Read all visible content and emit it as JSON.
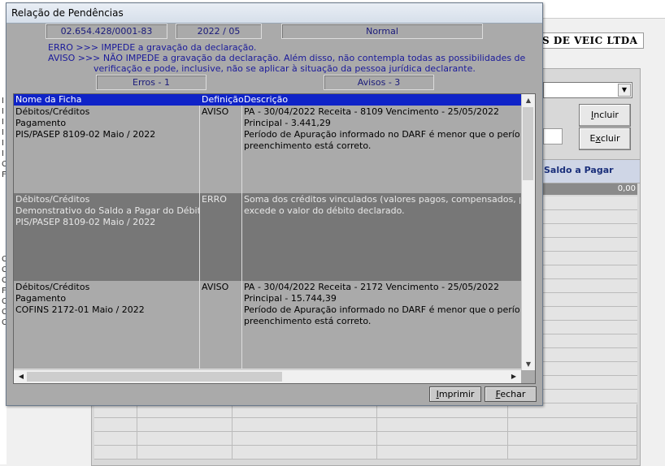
{
  "background": {
    "company_name": "S DE VEIC LTDA",
    "left_letters": [
      "I",
      "I",
      "I",
      "I",
      "I",
      "I",
      "C",
      "F",
      "",
      "",
      "",
      "",
      "",
      "",
      "",
      "C",
      "C",
      "C",
      "F",
      "C",
      "C",
      "C"
    ],
    "buttons": {
      "incluir": "Incluir",
      "excluir": "Excluir"
    },
    "saldo_header": "Saldo a Pagar",
    "saldo_value": "0,00"
  },
  "dialog": {
    "title": "Relação de Pendências",
    "cnpj": "02.654.428/0001-83",
    "periodo": "2022 / 05",
    "tipo": "Normal",
    "legend_erro": "ERRO >>>  IMPEDE a gravação da declaração.",
    "legend_aviso_1": "AVISO >>>  NÃO IMPEDE a gravação da declaração. Além disso, não contempla todas as possibilidades de",
    "legend_aviso_2": "verificação e pode, inclusive, não se aplicar à situação da pessoa jurídica declarante.",
    "erros_count": "Erros - 1",
    "avisos_count": "Avisos - 3",
    "columns": {
      "nome": "Nome da Ficha",
      "definicao": "Definição",
      "descricao": "Descrição"
    },
    "rows": [
      {
        "nome": [
          "Débitos/Créditos",
          "Pagamento",
          "PIS/PASEP  8109-02  Maio / 2022"
        ],
        "definicao": "AVISO",
        "descricao": [
          "PA - 30/04/2022 Receita - 8109 Vencimento - 25/05/2022",
          "Principal - 3.441,29",
          "Período de Apuração informado no DARF é menor que o período de apu",
          "preenchimento está correto."
        ],
        "selected": false
      },
      {
        "nome": [
          "Débitos/Créditos",
          "Demonstrativo do Saldo a Pagar do Débito",
          "PIS/PASEP  8109-02  Maio / 2022"
        ],
        "definicao": "ERRO",
        "descricao": [
          "Soma dos créditos vinculados (valores pagos, compensados, parcelados",
          "excede o valor do débito declarado."
        ],
        "selected": true
      },
      {
        "nome": [
          "Débitos/Créditos",
          "Pagamento",
          "COFINS  2172-01  Maio / 2022"
        ],
        "definicao": "AVISO",
        "descricao": [
          "PA - 30/04/2022 Receita - 2172 Vencimento - 25/05/2022",
          "Principal - 15.744,39",
          "Período de Apuração informado no DARF é menor que o período de apu",
          "preenchimento está correto."
        ],
        "selected": false
      }
    ],
    "buttons": {
      "imprimir": "Imprimir",
      "fechar": "Fechar"
    },
    "colors": {
      "header_bg": "#0f23c8",
      "selected_row": "#777777",
      "row_bg": "#aaaaaa",
      "legend_text": "#1a1a9a"
    }
  }
}
